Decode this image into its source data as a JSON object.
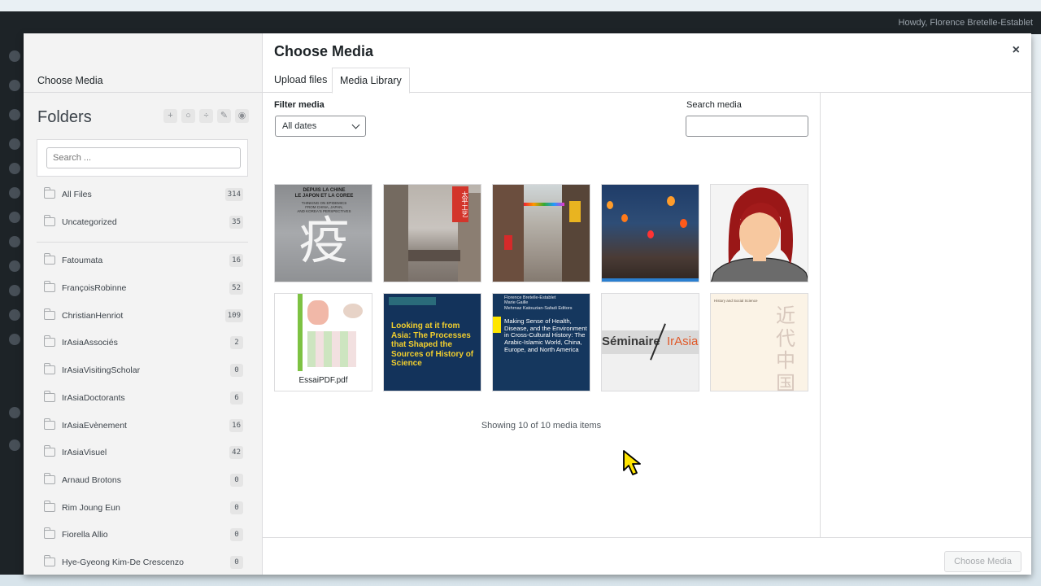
{
  "admin_bar": {
    "howdy": "Howdy, Florence Bretelle-Establet"
  },
  "modal": {
    "left_title": "Choose Media",
    "title": "Choose Media",
    "close": "×"
  },
  "folders": {
    "heading": "Folders",
    "search_placeholder": "Search ...",
    "tools": [
      "+",
      "○",
      "÷",
      "✎",
      "◉"
    ],
    "top_items": [
      {
        "label": "All Files",
        "count": "314"
      },
      {
        "label": "Uncategorized",
        "count": "35"
      }
    ],
    "items": [
      {
        "label": "Fatoumata",
        "count": "16"
      },
      {
        "label": "FrançoisRobinne",
        "count": "52"
      },
      {
        "label": "ChristianHenriot",
        "count": "109"
      },
      {
        "label": "IrAsiaAssociés",
        "count": "2"
      },
      {
        "label": "IrAsiaVisitingScholar",
        "count": "0"
      },
      {
        "label": "IrAsiaDoctorants",
        "count": "6"
      },
      {
        "label": "IrAsiaEvènement",
        "count": "16"
      },
      {
        "label": "IrAsiaVisuel",
        "count": "42"
      },
      {
        "label": "Arnaud Brotons",
        "count": "0"
      },
      {
        "label": "Rim Joung Eun",
        "count": "0"
      },
      {
        "label": "Fiorella Allio",
        "count": "0"
      },
      {
        "label": "Hye-Gyeong Kim-De Crescenzo",
        "count": "0"
      }
    ]
  },
  "tabs": {
    "upload": "Upload files",
    "library": "Media Library"
  },
  "filter": {
    "label": "Filter media",
    "selected": "All dates"
  },
  "search": {
    "label": "Search media",
    "value": ""
  },
  "media": {
    "book1": {
      "top": "DEPUIS LA CHINE\nLE JAPON ET LA COREE",
      "sub": "THINKING ON EPIDEMICS\nFROM CHINA, JAPAN,\nAND KOREA'S PERSPECTIVES",
      "glyph": "疫"
    },
    "street_sign": "太平工艺",
    "pdf_caption": "EssaiPDF.pdf",
    "book2_title": "Looking at it from Asia: The Processes that Shaped the Sources of History of Science",
    "book3_authors": "Florence Bretelle-Establet\nMarie Gaille\nMehrnaz Katouzian-Safadi  Editors",
    "book3_title": "Making Sense of Health, Disease, and the Environment in Cross-Cultural History: The Arabic-Islamic World, China, Europe, and North America",
    "seminaire_left": "Séminaire",
    "seminaire_right": "IrAsia",
    "book5_top": "History and Social Science",
    "book5_glyphs": "近代中国"
  },
  "status": "Showing 10 of 10 media items",
  "footer": {
    "choose": "Choose Media"
  }
}
